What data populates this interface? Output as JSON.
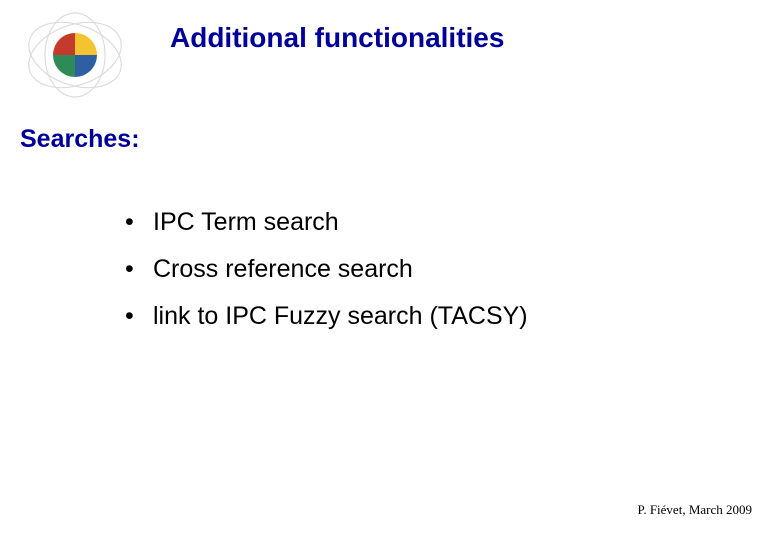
{
  "title": "Additional functionalities",
  "section": "Searches:",
  "bullets": {
    "item0": "IPC Term search",
    "item1": "Cross reference search",
    "item2": "link to IPC Fuzzy search (TACSY)"
  },
  "footer": "P. Fiévet, March 2009",
  "logo": {
    "colors": {
      "yellow": "#f4c430",
      "blue": "#2e5fa3",
      "green": "#2e8b57",
      "red": "#c43b2e"
    }
  }
}
